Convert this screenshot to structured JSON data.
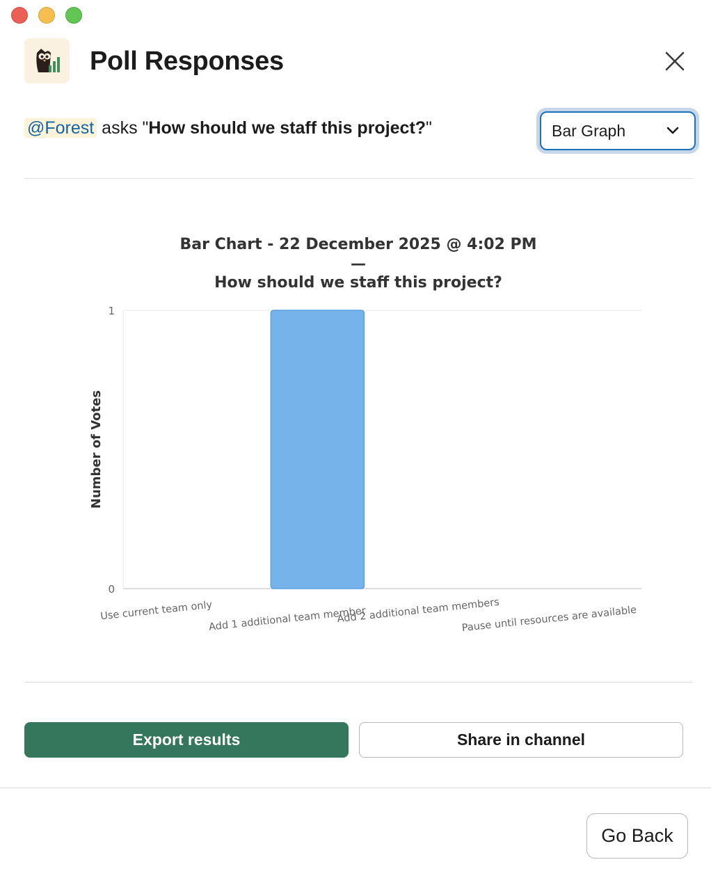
{
  "header": {
    "title": "Poll Responses"
  },
  "question": {
    "mention": "@Forest",
    "asks": " asks \"",
    "text": "How should we staff this project?",
    "closing_quote": "\""
  },
  "view_select": {
    "selected": "Bar Graph"
  },
  "colors": {
    "bar": "#76b3ea",
    "bar_border": "#5a9fdf",
    "export_button": "#34775c",
    "mention_bg": "#fdf3d8",
    "mention_text": "#1264a3"
  },
  "chart_data": {
    "type": "bar",
    "title_line1": "Bar Chart - 22 December 2025 @ 4:02 PM",
    "title_line2": "—",
    "title_line3": "How should we staff this project?",
    "ylabel": "Number of Votes",
    "xlabel": "",
    "categories": [
      "Use current team only",
      "Add 1 additional team member",
      "Add 2 additional team members",
      "Pause until resources are available"
    ],
    "values": [
      0,
      1,
      0,
      0
    ],
    "ylim": [
      0,
      1
    ],
    "yticks": [
      "0",
      "1"
    ],
    "grid": true
  },
  "buttons": {
    "export": "Export results",
    "share": "Share in channel",
    "go_back": "Go Back"
  },
  "icons": {
    "app": "owl-chart-icon",
    "close": "close-icon",
    "dropdown": "chevron-down-icon"
  }
}
